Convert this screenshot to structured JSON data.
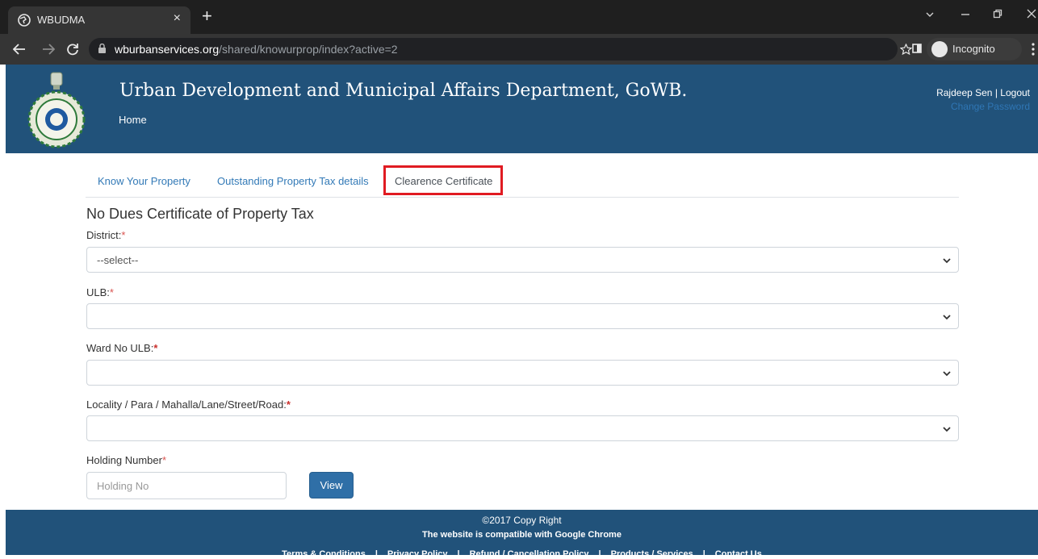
{
  "browser": {
    "tab_title": "WBUDMA",
    "tab_close": "×",
    "new_tab": "+",
    "url_host": "wburbanservices.org",
    "url_path": "/shared/knowurprop/index?active=2",
    "incognito_label": "Incognito",
    "icons": [
      "globe-icon",
      "close-icon",
      "back-arrow-icon",
      "forward-arrow-icon",
      "reload-icon",
      "lock-icon",
      "star-icon",
      "sidepanel-icon",
      "incognito-icon",
      "kebab-menu-icon",
      "minimize-icon",
      "restore-icon",
      "chevron-down-icon"
    ]
  },
  "header": {
    "title": "Urban Development and Municipal Affairs Department, GoWB.",
    "home": "Home",
    "user_name": "Rajdeep Sen",
    "separator": "|",
    "logout": "Logout",
    "change_password": "Change Password"
  },
  "tabs": [
    {
      "label": "Know Your Property"
    },
    {
      "label": "Outstanding Property Tax details"
    },
    {
      "label": "Clearence Certificate"
    }
  ],
  "form": {
    "title": "No Dues Certificate of Property Tax",
    "required_mark": "*",
    "district_label": "District:",
    "district_value": "--select--",
    "ulb_label": "ULB:",
    "ulb_value": "",
    "ward_label": "Ward No ULB:",
    "ward_value": "",
    "locality_label": "Locality / Para / Mahalla/Lane/Street/Road:",
    "locality_value": "",
    "holding_label": "Holding Number",
    "holding_placeholder": "Holding No",
    "view_button": "View"
  },
  "footer": {
    "copyright": "©2017 Copy Right",
    "compatibility": "The website is compatible with Google Chrome",
    "links": [
      "Terms & Conditions",
      "Privacy Policy",
      "Refund / Cancellation Policy",
      "Products / Services",
      "Contact Us"
    ],
    "link_separator": "|"
  },
  "colors": {
    "header_bg": "#21527a",
    "link": "#337ab7",
    "highlight_box": "#e01b22",
    "view_button": "#2f6fa7"
  }
}
